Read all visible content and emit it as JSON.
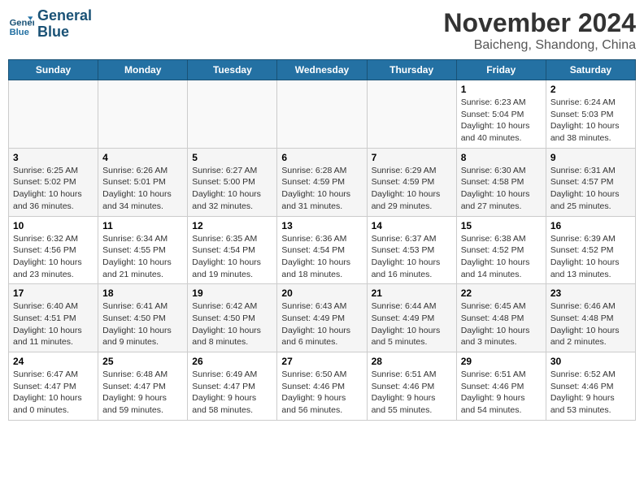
{
  "logo": {
    "text_line1": "General",
    "text_line2": "Blue"
  },
  "header": {
    "month": "November 2024",
    "location": "Baicheng, Shandong, China"
  },
  "weekdays": [
    "Sunday",
    "Monday",
    "Tuesday",
    "Wednesday",
    "Thursday",
    "Friday",
    "Saturday"
  ],
  "weeks": [
    [
      {
        "day": "",
        "info": ""
      },
      {
        "day": "",
        "info": ""
      },
      {
        "day": "",
        "info": ""
      },
      {
        "day": "",
        "info": ""
      },
      {
        "day": "",
        "info": ""
      },
      {
        "day": "1",
        "info": "Sunrise: 6:23 AM\nSunset: 5:04 PM\nDaylight: 10 hours and 40 minutes."
      },
      {
        "day": "2",
        "info": "Sunrise: 6:24 AM\nSunset: 5:03 PM\nDaylight: 10 hours and 38 minutes."
      }
    ],
    [
      {
        "day": "3",
        "info": "Sunrise: 6:25 AM\nSunset: 5:02 PM\nDaylight: 10 hours and 36 minutes."
      },
      {
        "day": "4",
        "info": "Sunrise: 6:26 AM\nSunset: 5:01 PM\nDaylight: 10 hours and 34 minutes."
      },
      {
        "day": "5",
        "info": "Sunrise: 6:27 AM\nSunset: 5:00 PM\nDaylight: 10 hours and 32 minutes."
      },
      {
        "day": "6",
        "info": "Sunrise: 6:28 AM\nSunset: 4:59 PM\nDaylight: 10 hours and 31 minutes."
      },
      {
        "day": "7",
        "info": "Sunrise: 6:29 AM\nSunset: 4:59 PM\nDaylight: 10 hours and 29 minutes."
      },
      {
        "day": "8",
        "info": "Sunrise: 6:30 AM\nSunset: 4:58 PM\nDaylight: 10 hours and 27 minutes."
      },
      {
        "day": "9",
        "info": "Sunrise: 6:31 AM\nSunset: 4:57 PM\nDaylight: 10 hours and 25 minutes."
      }
    ],
    [
      {
        "day": "10",
        "info": "Sunrise: 6:32 AM\nSunset: 4:56 PM\nDaylight: 10 hours and 23 minutes."
      },
      {
        "day": "11",
        "info": "Sunrise: 6:34 AM\nSunset: 4:55 PM\nDaylight: 10 hours and 21 minutes."
      },
      {
        "day": "12",
        "info": "Sunrise: 6:35 AM\nSunset: 4:54 PM\nDaylight: 10 hours and 19 minutes."
      },
      {
        "day": "13",
        "info": "Sunrise: 6:36 AM\nSunset: 4:54 PM\nDaylight: 10 hours and 18 minutes."
      },
      {
        "day": "14",
        "info": "Sunrise: 6:37 AM\nSunset: 4:53 PM\nDaylight: 10 hours and 16 minutes."
      },
      {
        "day": "15",
        "info": "Sunrise: 6:38 AM\nSunset: 4:52 PM\nDaylight: 10 hours and 14 minutes."
      },
      {
        "day": "16",
        "info": "Sunrise: 6:39 AM\nSunset: 4:52 PM\nDaylight: 10 hours and 13 minutes."
      }
    ],
    [
      {
        "day": "17",
        "info": "Sunrise: 6:40 AM\nSunset: 4:51 PM\nDaylight: 10 hours and 11 minutes."
      },
      {
        "day": "18",
        "info": "Sunrise: 6:41 AM\nSunset: 4:50 PM\nDaylight: 10 hours and 9 minutes."
      },
      {
        "day": "19",
        "info": "Sunrise: 6:42 AM\nSunset: 4:50 PM\nDaylight: 10 hours and 8 minutes."
      },
      {
        "day": "20",
        "info": "Sunrise: 6:43 AM\nSunset: 4:49 PM\nDaylight: 10 hours and 6 minutes."
      },
      {
        "day": "21",
        "info": "Sunrise: 6:44 AM\nSunset: 4:49 PM\nDaylight: 10 hours and 5 minutes."
      },
      {
        "day": "22",
        "info": "Sunrise: 6:45 AM\nSunset: 4:48 PM\nDaylight: 10 hours and 3 minutes."
      },
      {
        "day": "23",
        "info": "Sunrise: 6:46 AM\nSunset: 4:48 PM\nDaylight: 10 hours and 2 minutes."
      }
    ],
    [
      {
        "day": "24",
        "info": "Sunrise: 6:47 AM\nSunset: 4:47 PM\nDaylight: 10 hours and 0 minutes."
      },
      {
        "day": "25",
        "info": "Sunrise: 6:48 AM\nSunset: 4:47 PM\nDaylight: 9 hours and 59 minutes."
      },
      {
        "day": "26",
        "info": "Sunrise: 6:49 AM\nSunset: 4:47 PM\nDaylight: 9 hours and 58 minutes."
      },
      {
        "day": "27",
        "info": "Sunrise: 6:50 AM\nSunset: 4:46 PM\nDaylight: 9 hours and 56 minutes."
      },
      {
        "day": "28",
        "info": "Sunrise: 6:51 AM\nSunset: 4:46 PM\nDaylight: 9 hours and 55 minutes."
      },
      {
        "day": "29",
        "info": "Sunrise: 6:51 AM\nSunset: 4:46 PM\nDaylight: 9 hours and 54 minutes."
      },
      {
        "day": "30",
        "info": "Sunrise: 6:52 AM\nSunset: 4:46 PM\nDaylight: 9 hours and 53 minutes."
      }
    ]
  ]
}
